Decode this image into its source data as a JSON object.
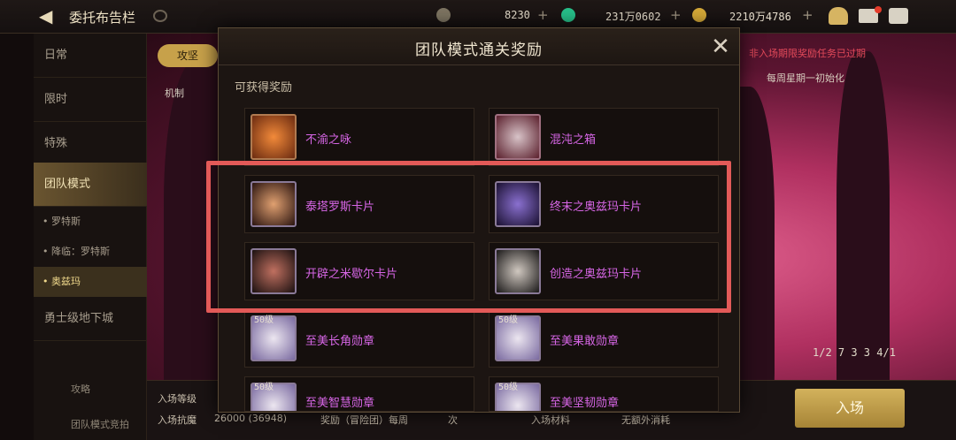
{
  "topbar": {
    "title": "委托布告栏",
    "currency1": "8230",
    "currency2": "231万0602",
    "currency3": "2210万4786"
  },
  "sidebar": {
    "items": [
      "日常",
      "限时",
      "特殊",
      "团队模式"
    ],
    "sub_items": [
      "• 罗特斯",
      "• 降临：罗特斯",
      "• 奥兹玛"
    ],
    "extra_item": "勇士级地下城",
    "bottom1": "攻略",
    "bottom2": "团队模式竞拍"
  },
  "main": {
    "tab_attack": "攻坚",
    "mech": "机制"
  },
  "right": {
    "warning": "非入场期限奖励任务已过期",
    "weekly": "每周星期一初始化",
    "party": "1/2  7 3 3  4/1"
  },
  "bottom": {
    "level_label": "入场等级",
    "fame_label": "入场抗魔",
    "fame_value": "26000 (36948)",
    "reward_label": "奖励（冒险团）每周",
    "reward_count": "次",
    "material_label": "入场材料",
    "material_value": "无额外消耗",
    "enter": "入场"
  },
  "modal": {
    "title": "团队模式通关奖励",
    "subtitle": "可获得奖励",
    "rewards": [
      {
        "name": "不渝之咏",
        "qty": ""
      },
      {
        "name": "混沌之箱",
        "qty": ""
      },
      {
        "name": "泰塔罗斯卡片",
        "qty": ""
      },
      {
        "name": "终末之奥兹玛卡片",
        "qty": ""
      },
      {
        "name": "开辟之米歇尔卡片",
        "qty": ""
      },
      {
        "name": "创造之奥兹玛卡片",
        "qty": ""
      },
      {
        "name": "至美长角勋章",
        "qty": "50级"
      },
      {
        "name": "至美果敢勋章",
        "qty": "50级"
      },
      {
        "name": "至美智慧勋章",
        "qty": "50级"
      },
      {
        "name": "至美坚韧勋章",
        "qty": "50级"
      }
    ]
  },
  "colors": {
    "reward_text": "#d766e6",
    "highlight": "#e35a58",
    "accent_gold": "#c7a14a"
  }
}
